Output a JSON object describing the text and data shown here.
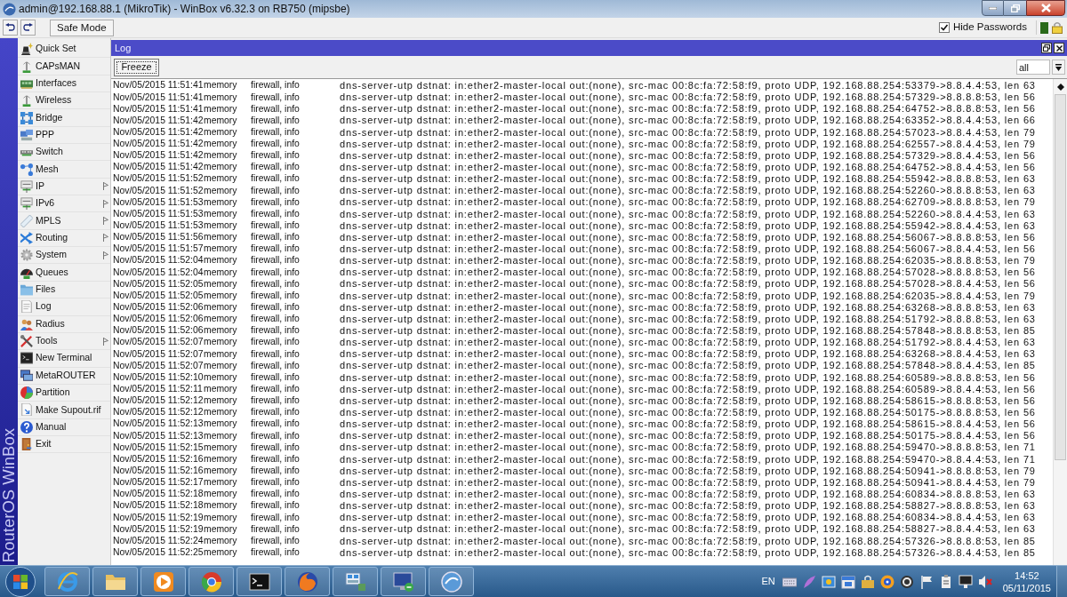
{
  "window": {
    "title": "admin@192.168.88.1 (MikroTik) - WinBox v6.32.3 on RB750 (mipsbe)"
  },
  "toolbar": {
    "safe_mode_button": "Safe Mode",
    "hide_passwords": {
      "label": "Hide Passwords",
      "checked": true
    }
  },
  "sidebar": {
    "brand": "RouterOS WinBox",
    "items": [
      {
        "label": "Quick Set",
        "submenu": false
      },
      {
        "label": "CAPsMAN",
        "submenu": false
      },
      {
        "label": "Interfaces",
        "submenu": false
      },
      {
        "label": "Wireless",
        "submenu": false
      },
      {
        "label": "Bridge",
        "submenu": false
      },
      {
        "label": "PPP",
        "submenu": false
      },
      {
        "label": "Switch",
        "submenu": false
      },
      {
        "label": "Mesh",
        "submenu": false
      },
      {
        "label": "IP",
        "submenu": true
      },
      {
        "label": "IPv6",
        "submenu": true
      },
      {
        "label": "MPLS",
        "submenu": true
      },
      {
        "label": "Routing",
        "submenu": true
      },
      {
        "label": "System",
        "submenu": true
      },
      {
        "label": "Queues",
        "submenu": false
      },
      {
        "label": "Files",
        "submenu": false
      },
      {
        "label": "Log",
        "submenu": false
      },
      {
        "label": "Radius",
        "submenu": false
      },
      {
        "label": "Tools",
        "submenu": true
      },
      {
        "label": "New Terminal",
        "submenu": false
      },
      {
        "label": "MetaROUTER",
        "submenu": false
      },
      {
        "label": "Partition",
        "submenu": false
      },
      {
        "label": "Make Supout.rif",
        "submenu": false
      },
      {
        "label": "Manual",
        "submenu": false
      },
      {
        "label": "Exit",
        "submenu": false
      }
    ]
  },
  "log_window": {
    "title": "Log",
    "freeze_button": "Freeze",
    "filter": {
      "value": "all"
    },
    "rows": [
      {
        "time": "Nov/05/2015 11:51:41",
        "buffer": "memory",
        "topics": "firewall, info",
        "message": "dns-server-utp dstnat: in:ether2-master-local out:(none), src-mac 00:8c:fa:72:58:f9, proto UDP, 192.168.88.254:53379->8.8.4.4:53, len 63"
      },
      {
        "time": "Nov/05/2015 11:51:41",
        "buffer": "memory",
        "topics": "firewall, info",
        "message": "dns-server-utp dstnat: in:ether2-master-local out:(none), src-mac 00:8c:fa:72:58:f9, proto UDP, 192.168.88.254:57329->8.8.8.8:53, len 56"
      },
      {
        "time": "Nov/05/2015 11:51:41",
        "buffer": "memory",
        "topics": "firewall, info",
        "message": "dns-server-utp dstnat: in:ether2-master-local out:(none), src-mac 00:8c:fa:72:58:f9, proto UDP, 192.168.88.254:64752->8.8.8.8:53, len 56"
      },
      {
        "time": "Nov/05/2015 11:51:42",
        "buffer": "memory",
        "topics": "firewall, info",
        "message": "dns-server-utp dstnat: in:ether2-master-local out:(none), src-mac 00:8c:fa:72:58:f9, proto UDP, 192.168.88.254:63352->8.8.4.4:53, len 66"
      },
      {
        "time": "Nov/05/2015 11:51:42",
        "buffer": "memory",
        "topics": "firewall, info",
        "message": "dns-server-utp dstnat: in:ether2-master-local out:(none), src-mac 00:8c:fa:72:58:f9, proto UDP, 192.168.88.254:57023->8.8.4.4:53, len 79"
      },
      {
        "time": "Nov/05/2015 11:51:42",
        "buffer": "memory",
        "topics": "firewall, info",
        "message": "dns-server-utp dstnat: in:ether2-master-local out:(none), src-mac 00:8c:fa:72:58:f9, proto UDP, 192.168.88.254:62557->8.8.4.4:53, len 79"
      },
      {
        "time": "Nov/05/2015 11:51:42",
        "buffer": "memory",
        "topics": "firewall, info",
        "message": "dns-server-utp dstnat: in:ether2-master-local out:(none), src-mac 00:8c:fa:72:58:f9, proto UDP, 192.168.88.254:57329->8.8.4.4:53, len 56"
      },
      {
        "time": "Nov/05/2015 11:51:42",
        "buffer": "memory",
        "topics": "firewall, info",
        "message": "dns-server-utp dstnat: in:ether2-master-local out:(none), src-mac 00:8c:fa:72:58:f9, proto UDP, 192.168.88.254:64752->8.8.4.4:53, len 56"
      },
      {
        "time": "Nov/05/2015 11:51:52",
        "buffer": "memory",
        "topics": "firewall, info",
        "message": "dns-server-utp dstnat: in:ether2-master-local out:(none), src-mac 00:8c:fa:72:58:f9, proto UDP, 192.168.88.254:55942->8.8.8.8:53, len 63"
      },
      {
        "time": "Nov/05/2015 11:51:52",
        "buffer": "memory",
        "topics": "firewall, info",
        "message": "dns-server-utp dstnat: in:ether2-master-local out:(none), src-mac 00:8c:fa:72:58:f9, proto UDP, 192.168.88.254:52260->8.8.8.8:53, len 63"
      },
      {
        "time": "Nov/05/2015 11:51:53",
        "buffer": "memory",
        "topics": "firewall, info",
        "message": "dns-server-utp dstnat: in:ether2-master-local out:(none), src-mac 00:8c:fa:72:58:f9, proto UDP, 192.168.88.254:62709->8.8.8.8:53, len 79"
      },
      {
        "time": "Nov/05/2015 11:51:53",
        "buffer": "memory",
        "topics": "firewall, info",
        "message": "dns-server-utp dstnat: in:ether2-master-local out:(none), src-mac 00:8c:fa:72:58:f9, proto UDP, 192.168.88.254:52260->8.8.4.4:53, len 63"
      },
      {
        "time": "Nov/05/2015 11:51:53",
        "buffer": "memory",
        "topics": "firewall, info",
        "message": "dns-server-utp dstnat: in:ether2-master-local out:(none), src-mac 00:8c:fa:72:58:f9, proto UDP, 192.168.88.254:55942->8.8.4.4:53, len 63"
      },
      {
        "time": "Nov/05/2015 11:51:56",
        "buffer": "memory",
        "topics": "firewall, info",
        "message": "dns-server-utp dstnat: in:ether2-master-local out:(none), src-mac 00:8c:fa:72:58:f9, proto UDP, 192.168.88.254:56067->8.8.8.8:53, len 56"
      },
      {
        "time": "Nov/05/2015 11:51:57",
        "buffer": "memory",
        "topics": "firewall, info",
        "message": "dns-server-utp dstnat: in:ether2-master-local out:(none), src-mac 00:8c:fa:72:58:f9, proto UDP, 192.168.88.254:56067->8.8.4.4:53, len 56"
      },
      {
        "time": "Nov/05/2015 11:52:04",
        "buffer": "memory",
        "topics": "firewall, info",
        "message": "dns-server-utp dstnat: in:ether2-master-local out:(none), src-mac 00:8c:fa:72:58:f9, proto UDP, 192.168.88.254:62035->8.8.8.8:53, len 79"
      },
      {
        "time": "Nov/05/2015 11:52:04",
        "buffer": "memory",
        "topics": "firewall, info",
        "message": "dns-server-utp dstnat: in:ether2-master-local out:(none), src-mac 00:8c:fa:72:58:f9, proto UDP, 192.168.88.254:57028->8.8.8.8:53, len 56"
      },
      {
        "time": "Nov/05/2015 11:52:05",
        "buffer": "memory",
        "topics": "firewall, info",
        "message": "dns-server-utp dstnat: in:ether2-master-local out:(none), src-mac 00:8c:fa:72:58:f9, proto UDP, 192.168.88.254:57028->8.8.4.4:53, len 56"
      },
      {
        "time": "Nov/05/2015 11:52:05",
        "buffer": "memory",
        "topics": "firewall, info",
        "message": "dns-server-utp dstnat: in:ether2-master-local out:(none), src-mac 00:8c:fa:72:58:f9, proto UDP, 192.168.88.254:62035->8.8.4.4:53, len 79"
      },
      {
        "time": "Nov/05/2015 11:52:06",
        "buffer": "memory",
        "topics": "firewall, info",
        "message": "dns-server-utp dstnat: in:ether2-master-local out:(none), src-mac 00:8c:fa:72:58:f9, proto UDP, 192.168.88.254:63268->8.8.8.8:53, len 63"
      },
      {
        "time": "Nov/05/2015 11:52:06",
        "buffer": "memory",
        "topics": "firewall, info",
        "message": "dns-server-utp dstnat: in:ether2-master-local out:(none), src-mac 00:8c:fa:72:58:f9, proto UDP, 192.168.88.254:51792->8.8.8.8:53, len 63"
      },
      {
        "time": "Nov/05/2015 11:52:06",
        "buffer": "memory",
        "topics": "firewall, info",
        "message": "dns-server-utp dstnat: in:ether2-master-local out:(none), src-mac 00:8c:fa:72:58:f9, proto UDP, 192.168.88.254:57848->8.8.8.8:53, len 85"
      },
      {
        "time": "Nov/05/2015 11:52:07",
        "buffer": "memory",
        "topics": "firewall, info",
        "message": "dns-server-utp dstnat: in:ether2-master-local out:(none), src-mac 00:8c:fa:72:58:f9, proto UDP, 192.168.88.254:51792->8.8.4.4:53, len 63"
      },
      {
        "time": "Nov/05/2015 11:52:07",
        "buffer": "memory",
        "topics": "firewall, info",
        "message": "dns-server-utp dstnat: in:ether2-master-local out:(none), src-mac 00:8c:fa:72:58:f9, proto UDP, 192.168.88.254:63268->8.8.4.4:53, len 63"
      },
      {
        "time": "Nov/05/2015 11:52:07",
        "buffer": "memory",
        "topics": "firewall, info",
        "message": "dns-server-utp dstnat: in:ether2-master-local out:(none), src-mac 00:8c:fa:72:58:f9, proto UDP, 192.168.88.254:57848->8.8.4.4:53, len 85"
      },
      {
        "time": "Nov/05/2015 11:52:10",
        "buffer": "memory",
        "topics": "firewall, info",
        "message": "dns-server-utp dstnat: in:ether2-master-local out:(none), src-mac 00:8c:fa:72:58:f9, proto UDP, 192.168.88.254:60589->8.8.8.8:53, len 56"
      },
      {
        "time": "Nov/05/2015 11:52:11",
        "buffer": "memory",
        "topics": "firewall, info",
        "message": "dns-server-utp dstnat: in:ether2-master-local out:(none), src-mac 00:8c:fa:72:58:f9, proto UDP, 192.168.88.254:60589->8.8.4.4:53, len 56"
      },
      {
        "time": "Nov/05/2015 11:52:12",
        "buffer": "memory",
        "topics": "firewall, info",
        "message": "dns-server-utp dstnat: in:ether2-master-local out:(none), src-mac 00:8c:fa:72:58:f9, proto UDP, 192.168.88.254:58615->8.8.8.8:53, len 56"
      },
      {
        "time": "Nov/05/2015 11:52:12",
        "buffer": "memory",
        "topics": "firewall, info",
        "message": "dns-server-utp dstnat: in:ether2-master-local out:(none), src-mac 00:8c:fa:72:58:f9, proto UDP, 192.168.88.254:50175->8.8.8.8:53, len 56"
      },
      {
        "time": "Nov/05/2015 11:52:13",
        "buffer": "memory",
        "topics": "firewall, info",
        "message": "dns-server-utp dstnat: in:ether2-master-local out:(none), src-mac 00:8c:fa:72:58:f9, proto UDP, 192.168.88.254:58615->8.8.4.4:53, len 56"
      },
      {
        "time": "Nov/05/2015 11:52:13",
        "buffer": "memory",
        "topics": "firewall, info",
        "message": "dns-server-utp dstnat: in:ether2-master-local out:(none), src-mac 00:8c:fa:72:58:f9, proto UDP, 192.168.88.254:50175->8.8.4.4:53, len 56"
      },
      {
        "time": "Nov/05/2015 11:52:15",
        "buffer": "memory",
        "topics": "firewall, info",
        "message": "dns-server-utp dstnat: in:ether2-master-local out:(none), src-mac 00:8c:fa:72:58:f9, proto UDP, 192.168.88.254:59470->8.8.8.8:53, len 71"
      },
      {
        "time": "Nov/05/2015 11:52:16",
        "buffer": "memory",
        "topics": "firewall, info",
        "message": "dns-server-utp dstnat: in:ether2-master-local out:(none), src-mac 00:8c:fa:72:58:f9, proto UDP, 192.168.88.254:59470->8.8.4.4:53, len 71"
      },
      {
        "time": "Nov/05/2015 11:52:16",
        "buffer": "memory",
        "topics": "firewall, info",
        "message": "dns-server-utp dstnat: in:ether2-master-local out:(none), src-mac 00:8c:fa:72:58:f9, proto UDP, 192.168.88.254:50941->8.8.8.8:53, len 79"
      },
      {
        "time": "Nov/05/2015 11:52:17",
        "buffer": "memory",
        "topics": "firewall, info",
        "message": "dns-server-utp dstnat: in:ether2-master-local out:(none), src-mac 00:8c:fa:72:58:f9, proto UDP, 192.168.88.254:50941->8.8.4.4:53, len 79"
      },
      {
        "time": "Nov/05/2015 11:52:18",
        "buffer": "memory",
        "topics": "firewall, info",
        "message": "dns-server-utp dstnat: in:ether2-master-local out:(none), src-mac 00:8c:fa:72:58:f9, proto UDP, 192.168.88.254:60834->8.8.8.8:53, len 63"
      },
      {
        "time": "Nov/05/2015 11:52:18",
        "buffer": "memory",
        "topics": "firewall, info",
        "message": "dns-server-utp dstnat: in:ether2-master-local out:(none), src-mac 00:8c:fa:72:58:f9, proto UDP, 192.168.88.254:58827->8.8.8.8:53, len 63"
      },
      {
        "time": "Nov/05/2015 11:52:19",
        "buffer": "memory",
        "topics": "firewall, info",
        "message": "dns-server-utp dstnat: in:ether2-master-local out:(none), src-mac 00:8c:fa:72:58:f9, proto UDP, 192.168.88.254:60834->8.8.4.4:53, len 63"
      },
      {
        "time": "Nov/05/2015 11:52:19",
        "buffer": "memory",
        "topics": "firewall, info",
        "message": "dns-server-utp dstnat: in:ether2-master-local out:(none), src-mac 00:8c:fa:72:58:f9, proto UDP, 192.168.88.254:58827->8.8.4.4:53, len 63"
      },
      {
        "time": "Nov/05/2015 11:52:24",
        "buffer": "memory",
        "topics": "firewall, info",
        "message": "dns-server-utp dstnat: in:ether2-master-local out:(none), src-mac 00:8c:fa:72:58:f9, proto UDP, 192.168.88.254:57326->8.8.8.8:53, len 85"
      },
      {
        "time": "Nov/05/2015 11:52:25",
        "buffer": "memory",
        "topics": "firewall, info",
        "message": "dns-server-utp dstnat: in:ether2-master-local out:(none), src-mac 00:8c:fa:72:58:f9, proto UDP, 192.168.88.254:57326->8.8.4.4:53, len 85"
      }
    ]
  },
  "taskbar": {
    "language": "EN",
    "time": "14:52",
    "date": "05/11/2015"
  }
}
